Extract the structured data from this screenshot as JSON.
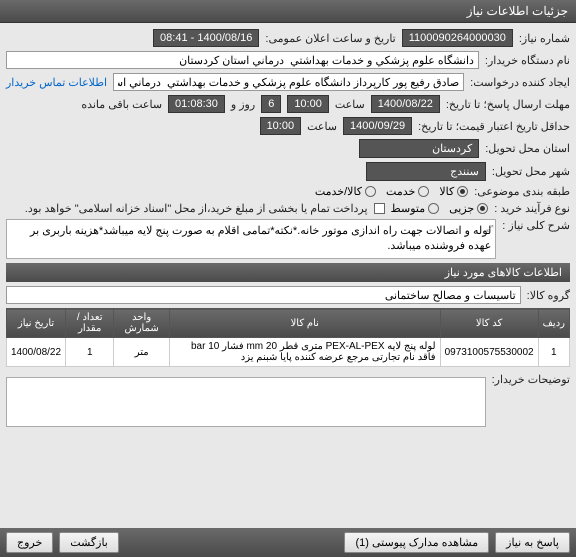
{
  "header": {
    "title": "جزئیات اطلاعات نیاز"
  },
  "fields": {
    "need_no_label": "شماره نیاز:",
    "need_no": "1100090264000030",
    "public_date_label": "تاریخ و ساعت اعلان عمومی:",
    "public_date": "1400/08/16 - 08:41",
    "buyer_label": "نام دستگاه خریدار:",
    "buyer": "دانشگاه علوم پزشكي و خدمات بهداشتي  درماني استان كردستان",
    "creator_label": "ایجاد کننده درخواست:",
    "creator": "صادق رفیع پور کارپرداز دانشگاه علوم پزشكي و خدمات بهداشتي  درماني است",
    "contact_link": "اطلاعات تماس خریدار",
    "deadline_label": "مهلت ارسال پاسخ؛ تا تاریخ:",
    "deadline_date": "1400/08/22",
    "hour_label": "ساعت",
    "deadline_time": "10:00",
    "day_label": "روز و",
    "days": "6",
    "remaining_label": "ساعت باقی مانده",
    "remaining_time": "01:08:30",
    "valid_label": "حداقل تاریخ اعتبار قیمت؛ تا تاریخ:",
    "valid_date": "1400/09/29",
    "valid_time": "10:00",
    "province_label": "استان محل تحویل:",
    "province": "كردستان",
    "city_label": "شهر محل تحویل:",
    "city": "سنندج",
    "category_label": "طبقه بندی موضوعی:",
    "cat_goods": "کالا",
    "cat_service": "خدمت",
    "cat_both": "کالا/خدمت",
    "process_label": "نوع فرآیند خرید :",
    "proc_tiny": "جزیی",
    "proc_medium": "متوسط",
    "payment_note": "پرداخت تمام یا بخشی از مبلغ خرید،از محل \"اسناد خزانه اسلامی\" خواهد بود."
  },
  "desc": {
    "label": "شرح کلی نیاز :",
    "text": "لوله و اتصالات جهت راه اندازی موتور خانه.*نکته*تمامی اقلام به صورت پنج لایه میباشد*هزینه باربری بر عهده فروشنده میباشد."
  },
  "items_section": {
    "title": "اطلاعات کالاهای مورد نیاز",
    "group_label": "گروه کالا:",
    "group": "تاسیسات و مصالح ساختمانی"
  },
  "table": {
    "headers": [
      "ردیف",
      "کد کالا",
      "نام کالا",
      "واحد شمارش",
      "تعداد / مقدار",
      "تاریخ نیاز"
    ],
    "rows": [
      {
        "idx": "1",
        "code": "0973100575530002",
        "name": "لوله پنج لایه PEX-AL-PEX متری قطر 20 mm فشار 10 bar فاقد نام تجارتی مرجع عرضه کننده پایا شبنم یزد",
        "unit": "متر",
        "qty": "1",
        "date": "1400/08/22"
      }
    ]
  },
  "buyer_notes": {
    "label": "توضیحات خریدار:"
  },
  "footer": {
    "reply": "پاسخ به نیاز",
    "attachments": "مشاهده مدارک پیوستی (1)",
    "back": "بازگشت",
    "exit": "خروج"
  }
}
